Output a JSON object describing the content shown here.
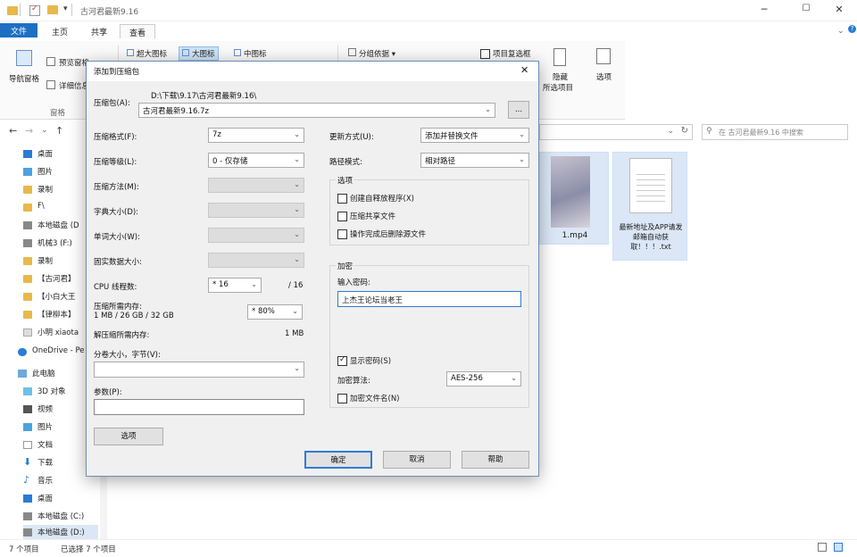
{
  "explorer": {
    "title": "古河君最新9.16",
    "tabs": [
      "文件",
      "主页",
      "共享",
      "查看"
    ],
    "ribbon": {
      "nav_pane": "导航窗格",
      "preview_pane": "预览窗格",
      "details_pane": "详细信息",
      "pane_group": "窗格",
      "view_xl": "超大图标",
      "view_l": "大图标",
      "view_m": "中图标",
      "group_by": "分组依据",
      "item_checkbox": "项目复选框",
      "hide_selected": "隐藏",
      "hide_selected2": "所选项目",
      "options": "选项"
    },
    "search_placeholder": "在 古河君最新9.16 中搜索",
    "sidebar": [
      "桌面",
      "图片",
      "录制",
      "F\\",
      "本地磁盘 (D",
      "机械3 (F:)",
      "录制",
      "【古河君】",
      "【小白大王",
      "【律柳本】",
      "小明 xiaota",
      "OneDrive - Pe",
      "此电脑",
      "3D 对象",
      "视频",
      "图片",
      "文档",
      "下载",
      "音乐",
      "桌面",
      "本地磁盘 (C:)",
      "本地磁盘 (D:)"
    ],
    "files": [
      {
        "name": "1.mp4"
      },
      {
        "name": "最新地址及APP请发邮箱自动获取！！！.txt"
      }
    ],
    "status_count": "7 个项目",
    "status_selected": "已选择 7 个项目"
  },
  "dialog": {
    "title": "添加到压缩包",
    "archive_label": "压缩包(A):",
    "archive_path": "D:\\下载\\9.17\\古河君最新9.16\\",
    "archive_name": "古河君最新9.16.7z",
    "browse": "...",
    "format_label": "压缩格式(F):",
    "format_value": "7z",
    "level_label": "压缩等级(L):",
    "level_value": "0 - 仅存储",
    "method_label": "压缩方法(M):",
    "dict_label": "字典大小(D):",
    "word_label": "单词大小(W):",
    "solid_label": "固实数据大小:",
    "cpu_label": "CPU 线程数:",
    "cpu_value": "* 16",
    "cpu_max": "/ 16",
    "mem_label": "压缩所需内存:",
    "mem_value": "1 MB / 26 GB / 32 GB",
    "mem_pct": "* 80%",
    "decomp_label": "解压缩所需内存:",
    "decomp_value": "1 MB",
    "split_label": "分卷大小，字节(V):",
    "params_label": "参数(P):",
    "options_btn": "选项",
    "update_label": "更新方式(U):",
    "update_value": "添加并替换文件",
    "path_label": "路径模式:",
    "path_value": "相对路径",
    "options_group": "选项",
    "opt_sfx": "创建自释放程序(X)",
    "opt_shared": "压缩共享文件",
    "opt_delete": "操作完成后删除源文件",
    "enc_group": "加密",
    "pwd_label": "输入密码:",
    "pwd_value": "上杰王论坛当老王",
    "show_pwd": "显示密码(S)",
    "enc_method_label": "加密算法:",
    "enc_method_value": "AES-256",
    "enc_names": "加密文件名(N)",
    "ok": "确定",
    "cancel": "取消",
    "help": "帮助"
  },
  "colors": {
    "accent": "#1d6fc3",
    "folder": "#e8b84a",
    "selection": "#dbe7f6"
  }
}
